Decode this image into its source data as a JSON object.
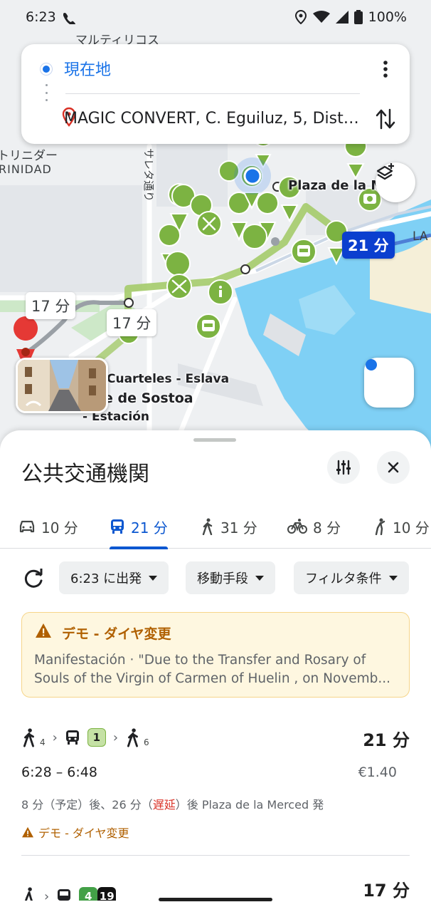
{
  "status_bar": {
    "time": "6:23",
    "battery": "100%"
  },
  "route_card": {
    "origin": "現在地",
    "destination": "MAGIC CONVERT, C. Eguiluz, 5, Distr..."
  },
  "map": {
    "labels": {
      "multi": "マルティリコス",
      "trinidad_jp": "トリニダー",
      "trinidad": "RINIDAD",
      "sareta": "サレタ通り",
      "plaza": "Plaza de la M",
      "la": "LA",
      "cuarteles": "Cuarteles - Eslava",
      "sostoa": "e de Sostoa",
      "estacion": "- Estación"
    },
    "chips": {
      "walk_left": "17 分",
      "walk_mid": "17 分",
      "transit": "21 分"
    }
  },
  "sheet": {
    "title": "公共交通機関",
    "tabs": [
      {
        "icon": "car-icon",
        "label": "10 分"
      },
      {
        "icon": "bus-icon",
        "label": "21 分"
      },
      {
        "icon": "walk-icon",
        "label": "31 分"
      },
      {
        "icon": "bike-icon",
        "label": "8 分"
      },
      {
        "icon": "rideshare-icon",
        "label": "10 分"
      }
    ],
    "filters": {
      "depart": "6:23 に出発",
      "modes": "移動手段",
      "options": "フィルタ条件"
    },
    "alert": {
      "title": "デモ - ダイヤ変更",
      "line1": "Manifestación · \"Due to the Transfer and Rosary of",
      "line2": "Souls of the Virgin of Carmen of Huelin , on Novemb..."
    },
    "routes": [
      {
        "walk1": "4",
        "line": "1",
        "walk2": "6",
        "duration": "21 分",
        "times": "6:28 – 6:48",
        "fare": "€1.40",
        "dep_a": "8 分（予定）後、26 分（",
        "dep_late": "遅延",
        "dep_b": "）後 Plaza de la Merced 発",
        "alert": "デモ - ダイヤ変更"
      },
      {
        "line_a": "4",
        "line_b": "19",
        "duration": "17 分"
      }
    ]
  },
  "colors": {
    "accent": "#0b57d0",
    "map_pin": "#7cb342",
    "route_blue": "#0b3fcf",
    "alert_text": "#b06000",
    "late": "#d93025",
    "water": "#7fd0f5"
  }
}
